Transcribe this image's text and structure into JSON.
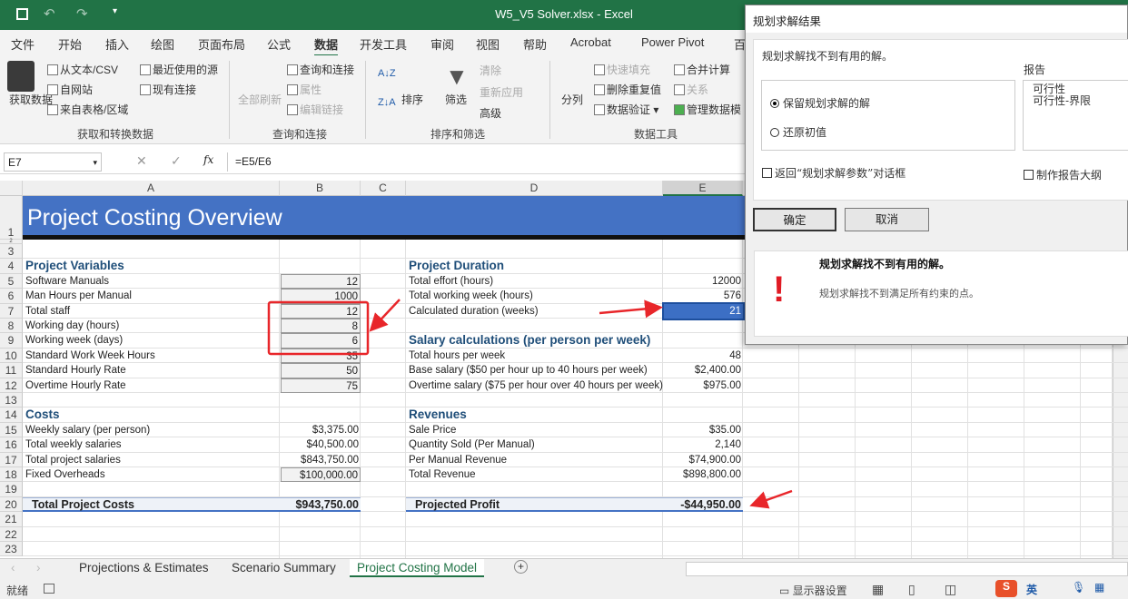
{
  "window": {
    "title": "W5_V5 Solver.xlsx - Excel"
  },
  "menu": [
    "文件",
    "开始",
    "插入",
    "绘图",
    "页面布局",
    "公式",
    "数据",
    "开发工具",
    "审阅",
    "视图",
    "帮助",
    "Acrobat",
    "Power Pivot",
    "百"
  ],
  "menu_active": 6,
  "ribbon": {
    "get_data": "获取数据",
    "from_text": "从文本/CSV",
    "from_web": "自网站",
    "from_table": "来自表格/区域",
    "recent": "最近使用的源",
    "existing": "现有连接",
    "group1": "获取和转换数据",
    "refresh_all": "全部刷新",
    "queries": "查询和连接",
    "properties": "属性",
    "edit_links": "编辑链接",
    "group2": "查询和连接",
    "sort": "排序",
    "filter": "筛选",
    "clear": "清除",
    "reapply": "重新应用",
    "advanced": "高级",
    "group3": "排序和筛选",
    "split": "分列",
    "flash_fill": "快速填充",
    "remove_dup": "删除重复值",
    "validation": "数据验证",
    "consolidate": "合并计算",
    "relations": "关系",
    "manage_model": "管理数据模",
    "group4": "数据工具"
  },
  "formula_bar": {
    "name_box": "E7",
    "formula": "=E5/E6",
    "fx": "fx"
  },
  "columns": [
    "A",
    "B",
    "C",
    "D",
    "E"
  ],
  "sheet": {
    "title": "Project Costing Overview",
    "rows": [
      {
        "n": "4",
        "a": "Project Variables",
        "d": "Project Duration",
        "hd": true
      },
      {
        "n": "5",
        "a": "Software Manuals",
        "b": "12",
        "d": "Total effort (hours)",
        "e": "12000"
      },
      {
        "n": "6",
        "a": "Man Hours per Manual",
        "b": "1000",
        "d": "Total working week (hours)",
        "e": "576"
      },
      {
        "n": "7",
        "a": "Total staff",
        "b": "12",
        "d": "Calculated duration (weeks)",
        "e": "21"
      },
      {
        "n": "8",
        "a": "Working day (hours)",
        "b": "8"
      },
      {
        "n": "9",
        "a": "Working week (days)",
        "b": "6",
        "d": "Salary calculations (per person per week)",
        "dhd": true
      },
      {
        "n": "10",
        "a": "Standard Work Week Hours",
        "b": "35",
        "d": "Total hours per week",
        "e": "48"
      },
      {
        "n": "11",
        "a": "Standard Hourly Rate",
        "b": "50",
        "d": "Base salary ($50 per hour up to 40 hours per week)",
        "e": "$2,400.00"
      },
      {
        "n": "12",
        "a": "Overtime Hourly Rate",
        "b": "75",
        "d": "Overtime salary ($75 per hour over 40 hours per week)",
        "e": "$975.00"
      },
      {
        "n": "13"
      },
      {
        "n": "14",
        "a": "Costs",
        "d": "Revenues",
        "hd": true
      },
      {
        "n": "15",
        "a": "Weekly salary (per person)",
        "b": "$3,375.00",
        "d": "Sale Price",
        "e": "$35.00"
      },
      {
        "n": "16",
        "a": "Total weekly salaries",
        "b": "$40,500.00",
        "d": "Quantity Sold (Per Manual)",
        "e": "2,140"
      },
      {
        "n": "17",
        "a": "Total project salaries",
        "b": "$843,750.00",
        "d": "Per Manual Revenue",
        "e": "$74,900.00"
      },
      {
        "n": "18",
        "a": "Fixed Overheads",
        "b": "$100,000.00",
        "d": "Total Revenue",
        "e": "$898,800.00"
      },
      {
        "n": "19"
      },
      {
        "n": "20",
        "a": "Total Project Costs",
        "b": "$943,750.00",
        "d": "Projected Profit",
        "e": "-$44,950.00",
        "tot": true
      },
      {
        "n": "21"
      },
      {
        "n": "22"
      },
      {
        "n": "23"
      }
    ]
  },
  "tabs": [
    "Projections & Estimates",
    "Scenario Summary",
    "Project Costing Model"
  ],
  "active_tab": 2,
  "status": {
    "ready": "就绪",
    "display_settings": "显示器设置",
    "ime": "英"
  },
  "dialog": {
    "title": "规划求解结果",
    "message": "规划求解找不到有用的解。",
    "keep": "保留规划求解的解",
    "restore": "还原初值",
    "reports_label": "报告",
    "reports": [
      "可行性",
      "可行性-界限"
    ],
    "return_dialog": "返回“规划求解参数”对话框",
    "outline": "制作报告大纲",
    "ok": "确定",
    "cancel": "取消",
    "detail_title": "规划求解找不到有用的解。",
    "detail_text": "规划求解找不到满足所有约束的点。"
  },
  "colors": {
    "excel_green": "#217346",
    "title_band": "#4472c4",
    "heading": "#1f4e79",
    "annotation": "#e8262a"
  }
}
